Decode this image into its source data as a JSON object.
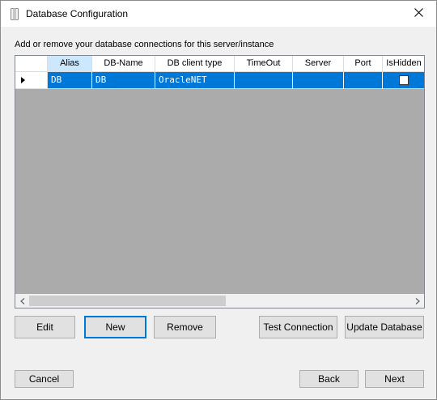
{
  "window": {
    "title": "Database Configuration"
  },
  "instruction": "Add or remove your database connections for this server/instance",
  "grid": {
    "columns": [
      "Alias",
      "DB-Name",
      "DB client type",
      "TimeOut",
      "Server",
      "Port",
      "IsHidden"
    ],
    "rows": [
      {
        "alias": "DB",
        "db_name": "DB",
        "client_type": "OracleNET",
        "timeout": "",
        "server": "",
        "port": "",
        "is_hidden": false,
        "selected": true
      }
    ]
  },
  "buttons": {
    "edit": "Edit",
    "new": "New",
    "remove": "Remove",
    "test_connection": "Test Connection",
    "update_database": "Update Database",
    "cancel": "Cancel",
    "back": "Back",
    "next": "Next"
  },
  "colors": {
    "selection": "#0078d7",
    "grid_background": "#ababab",
    "focus_border": "#0078d7"
  },
  "icons": {
    "app": "database-icon",
    "close": "close-icon",
    "row_pointer": "row-pointer-icon"
  }
}
